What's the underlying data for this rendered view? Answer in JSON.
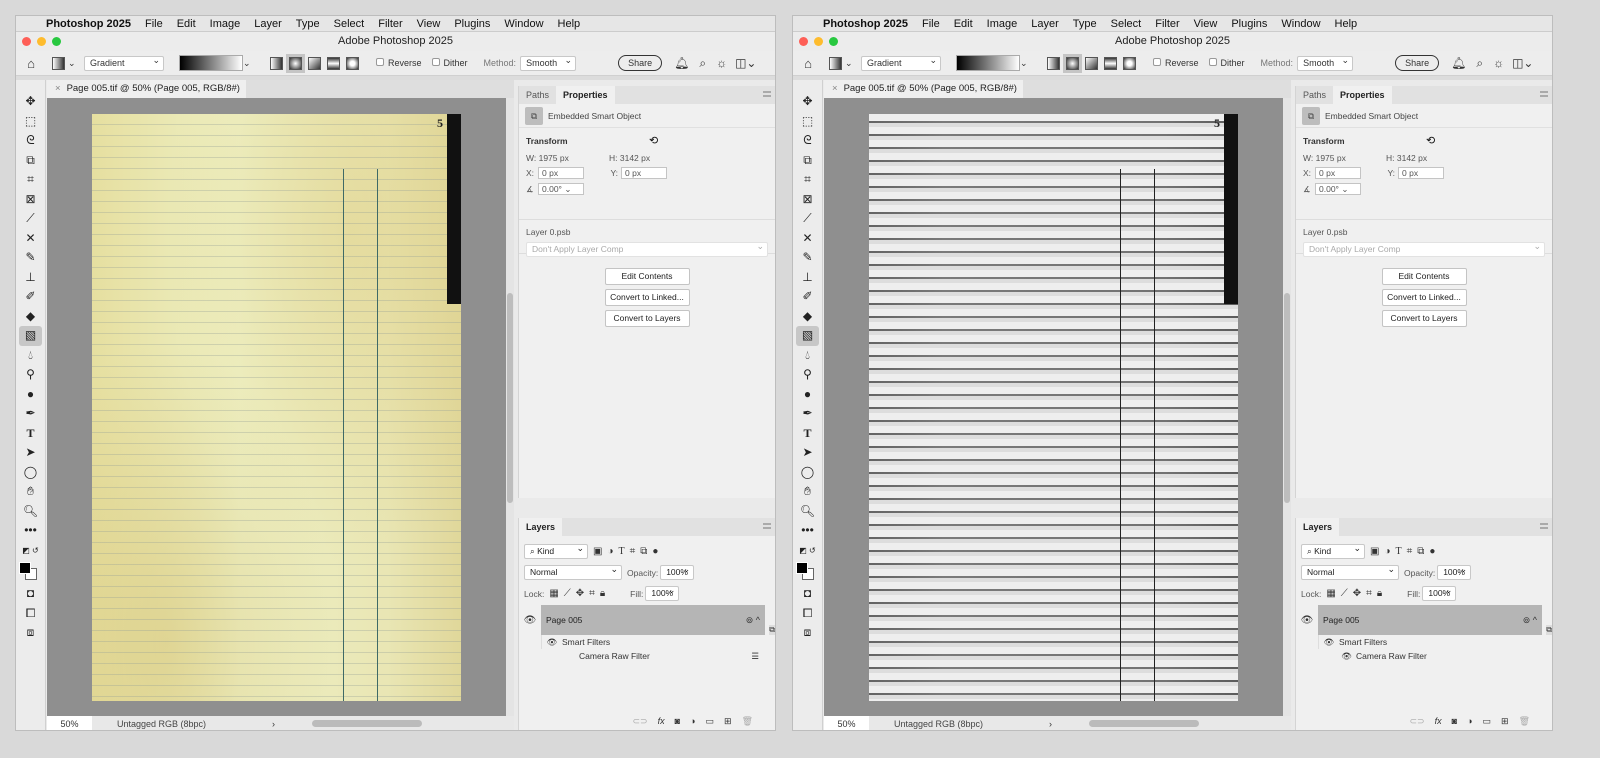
{
  "windows": [
    {
      "menubar": {
        "app": "Photoshop 2025",
        "items": [
          "File",
          "Edit",
          "Image",
          "Layer",
          "Type",
          "Select",
          "Filter",
          "View",
          "Plugins",
          "Window",
          "Help"
        ]
      },
      "title": "Adobe Photoshop 2025",
      "options": {
        "preset": "Gradient",
        "reverse": "Reverse",
        "dither": "Dither",
        "method_label": "Method:",
        "method": "Smooth",
        "share": "Share"
      },
      "doc_tab": "Page 005.tif @ 50% (Page 005, RGB/8#) *",
      "page_number": "5",
      "status": {
        "zoom": "50%",
        "info": "Untagged RGB (8bpc)"
      },
      "properties": {
        "tabs": [
          "Paths",
          "Properties"
        ],
        "object_type": "Embedded Smart Object",
        "transform_label": "Transform",
        "w": "W:  1975 px",
        "h": "H:  3142 px",
        "x_label": "X:",
        "x": "0 px",
        "y_label": "Y:",
        "y": "0 px",
        "angle": "0.00°",
        "source": "Layer 0.psb",
        "layer_comp": "Don't Apply Layer Comp",
        "buttons": [
          "Edit Contents",
          "Convert to Linked...",
          "Convert to Layers"
        ]
      },
      "layers": {
        "tab": "Layers",
        "kind": "Kind",
        "blend": "Normal",
        "opacity_label": "Opacity:",
        "opacity": "100%",
        "lock_label": "Lock:",
        "fill_label": "Fill:",
        "fill": "100%",
        "layer_name": "Page 005",
        "smart_filters": "Smart Filters",
        "filter": "Camera Raw Filter"
      },
      "page_tone": "color"
    },
    {
      "menubar": {
        "app": "Photoshop 2025",
        "items": [
          "File",
          "Edit",
          "Image",
          "Layer",
          "Type",
          "Select",
          "Filter",
          "View",
          "Plugins",
          "Window",
          "Help"
        ]
      },
      "title": "Adobe Photoshop 2025",
      "options": {
        "preset": "Gradient",
        "reverse": "Reverse",
        "dither": "Dither",
        "method_label": "Method:",
        "method": "Smooth",
        "share": "Share"
      },
      "doc_tab": "Page 005.tif @ 50% (Page 005, RGB/8#) *",
      "page_number": "5",
      "status": {
        "zoom": "50%",
        "info": "Untagged RGB (8bpc)"
      },
      "properties": {
        "tabs": [
          "Paths",
          "Properties"
        ],
        "object_type": "Embedded Smart Object",
        "transform_label": "Transform",
        "w": "W:  1975 px",
        "h": "H:  3142 px",
        "x_label": "X:",
        "x": "0 px",
        "y_label": "Y:",
        "y": "0 px",
        "angle": "0.00°",
        "source": "Layer 0.psb",
        "layer_comp": "Don't Apply Layer Comp",
        "buttons": [
          "Edit Contents",
          "Convert to Linked...",
          "Convert to Layers"
        ]
      },
      "layers": {
        "tab": "Layers",
        "kind": "Kind",
        "blend": "Normal",
        "opacity_label": "Opacity:",
        "opacity": "100%",
        "lock_label": "Lock:",
        "fill_label": "Fill:",
        "fill": "100%",
        "layer_name": "Page 005",
        "smart_filters": "Smart Filters",
        "filter": "Camera Raw Filter"
      },
      "page_tone": "grayscale"
    }
  ],
  "colors": {
    "accent_red": "#fe5f57",
    "accent_yellow": "#febc2e",
    "accent_green": "#28c840",
    "layer_selected": "#b5b5b5"
  }
}
